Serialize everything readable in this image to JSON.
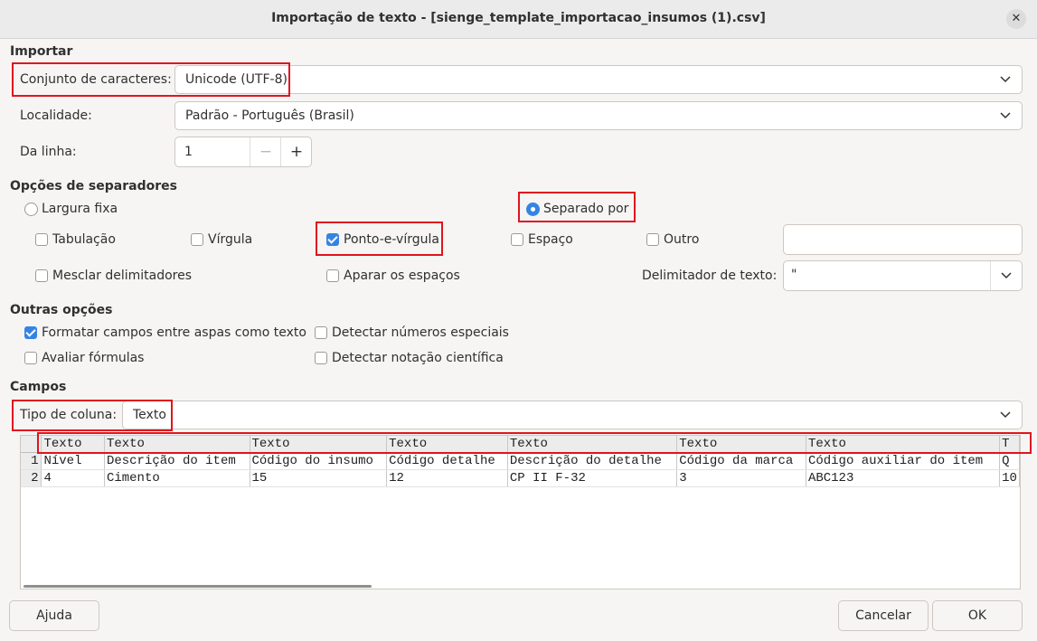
{
  "window": {
    "title": "Importação de texto - [sienge_template_importacao_insumos (1).csv]"
  },
  "importar": {
    "heading": "Importar",
    "charset_label": "Conjunto de caracteres:",
    "charset_value": "Unicode (UTF-8)",
    "locale_label": "Localidade:",
    "locale_value": "Padrão - Português (Brasil)",
    "from_row_label": "Da linha:",
    "from_row_value": "1"
  },
  "separators": {
    "heading": "Opções de separadores",
    "fixed_width": "Largura fixa",
    "separated_by": "Separado por",
    "tab": "Tabulação",
    "comma": "Vírgula",
    "semicolon": "Ponto-e-vírgula",
    "space": "Espaço",
    "other": "Outro",
    "other_value": "",
    "merge": "Mesclar delimitadores",
    "trim": "Aparar os espaços",
    "string_delim_label": "Delimitador de texto:",
    "string_delim_value": "\""
  },
  "other_options": {
    "heading": "Outras opções",
    "quoted_as_text": "Formatar campos entre aspas como texto",
    "detect_special": "Detectar números especiais",
    "evaluate_formulas": "Avaliar fórmulas",
    "detect_scientific": "Detectar notação científica"
  },
  "fields": {
    "heading": "Campos",
    "column_type_label": "Tipo de coluna:",
    "column_type_value": "Texto",
    "headers": [
      "Texto",
      "Texto",
      "Texto",
      "Texto",
      "Texto",
      "Texto",
      "Texto",
      "T"
    ],
    "rows": [
      {
        "num": "1",
        "cells": [
          "Nível",
          "Descrição do item",
          "Código do insumo",
          "Código detalhe",
          "Descrição do detalhe",
          "Código da marca",
          "Código auxiliar do item",
          "Q"
        ]
      },
      {
        "num": "2",
        "cells": [
          "4",
          "Cimento",
          "15",
          "12",
          "CP II F-32",
          "3",
          "ABC123",
          "10"
        ]
      }
    ]
  },
  "buttons": {
    "help": "Ajuda",
    "cancel": "Cancelar",
    "ok": "OK"
  },
  "colors": {
    "accent": "#3584e4",
    "highlight": "#e0141e"
  }
}
